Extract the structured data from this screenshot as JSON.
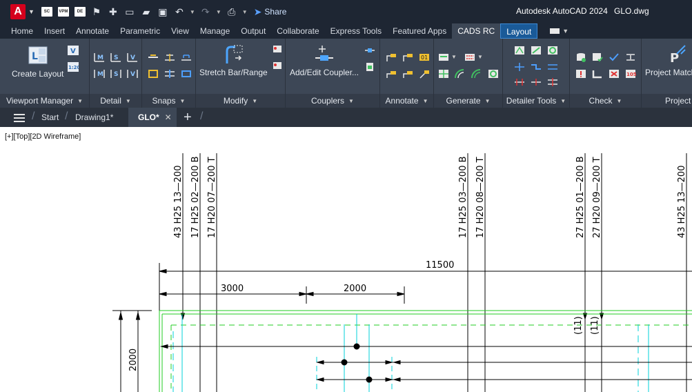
{
  "title_bar": {
    "app_title": "Autodesk AutoCAD 2024",
    "file_name": "GLO.dwg",
    "logo_letter": "A",
    "quick_access": [
      "SC",
      "VPM",
      "DE"
    ],
    "share_label": "Share"
  },
  "ribbon_tabs": [
    "Home",
    "Insert",
    "Annotate",
    "Parametric",
    "View",
    "Manage",
    "Output",
    "Collaborate",
    "Express Tools",
    "Featured Apps",
    "CADS RC",
    "Layout"
  ],
  "ribbon": {
    "viewport_manager": {
      "label": "Viewport Manager",
      "create_layout": "Create Layout",
      "btn_v": "V",
      "btn_scale": "1:20"
    },
    "detail": {
      "label": "Detail",
      "small_btns": [
        "M",
        "S",
        "V",
        "M",
        "S",
        "V"
      ]
    },
    "snaps": {
      "label": "Snaps"
    },
    "modify": {
      "label": "Modify",
      "stretch": "Stretch Bar/Range"
    },
    "couplers": {
      "label": "Couplers",
      "add_edit": "Add/Edit Coupler..."
    },
    "annotate": {
      "label": "Annotate"
    },
    "generate": {
      "label": "Generate"
    },
    "detailer_tools": {
      "label": "Detailer Tools"
    },
    "check": {
      "label": "Check"
    },
    "project": {
      "label": "Project",
      "project_match": "Project Match"
    }
  },
  "file_tabs": {
    "start": "Start",
    "drawing1": "Drawing1*",
    "glo": "GLO*",
    "add": "+"
  },
  "viewport_label": "[+][Top][2D Wireframe]",
  "drawing": {
    "bar_labels": {
      "b1": "43  H25  13—200",
      "b2": "17  H25  02—200  B",
      "b3": "17  H20  07—200  T",
      "b4": "17  H25  03—200  B",
      "b5": "17  H20  08—200  T",
      "b6": "27  H25  01—200  B",
      "b7": "27  H20  09—200  T",
      "b8": "43  H25  13—200"
    },
    "dim_overall": "11500",
    "dim_3000": "3000",
    "dim_2000_h": "2000",
    "dim_2000_v": "2000",
    "marker_11": "(11)"
  },
  "colors": {
    "title_bg": "#1e2633",
    "ribbon_bg": "#3d4756",
    "accent": "#1a5a98",
    "slab_edge": "#22cc22",
    "bar_cyan": "#00d0d8"
  }
}
